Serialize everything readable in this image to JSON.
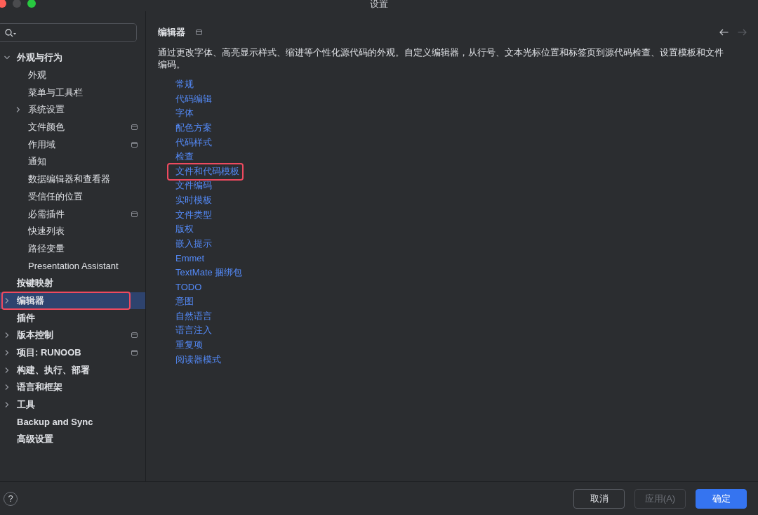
{
  "window": {
    "title": "设置"
  },
  "sidebar": {
    "items": [
      {
        "label": "外观与行为",
        "expanded": true,
        "selected": false,
        "highlighted": false,
        "scope_icon": false,
        "children": [
          {
            "label": "外观",
            "selected": false,
            "highlighted": false,
            "scope_icon": false
          },
          {
            "label": "菜单与工具栏",
            "selected": false,
            "highlighted": false,
            "scope_icon": false
          },
          {
            "label": "系统设置",
            "expanded": false,
            "selected": false,
            "highlighted": false,
            "scope_icon": false
          },
          {
            "label": "文件颜色",
            "selected": false,
            "highlighted": false,
            "scope_icon": true
          },
          {
            "label": "作用域",
            "selected": false,
            "highlighted": false,
            "scope_icon": true
          },
          {
            "label": "通知",
            "selected": false,
            "highlighted": false,
            "scope_icon": false
          },
          {
            "label": "数据编辑器和查看器",
            "selected": false,
            "highlighted": false,
            "scope_icon": false
          },
          {
            "label": "受信任的位置",
            "selected": false,
            "highlighted": false,
            "scope_icon": false
          },
          {
            "label": "必需插件",
            "selected": false,
            "highlighted": false,
            "scope_icon": true
          },
          {
            "label": "快速列表",
            "selected": false,
            "highlighted": false,
            "scope_icon": false
          },
          {
            "label": "路径变量",
            "selected": false,
            "highlighted": false,
            "scope_icon": false
          },
          {
            "label": "Presentation Assistant",
            "selected": false,
            "highlighted": false,
            "scope_icon": false
          }
        ]
      },
      {
        "label": "按键映射",
        "selected": false,
        "highlighted": false,
        "scope_icon": false
      },
      {
        "label": "编辑器",
        "expanded": false,
        "selected": true,
        "highlighted": true,
        "scope_icon": false
      },
      {
        "label": "插件",
        "selected": false,
        "highlighted": false,
        "scope_icon": false
      },
      {
        "label": "版本控制",
        "expanded": false,
        "selected": false,
        "highlighted": false,
        "scope_icon": true
      },
      {
        "label": "项目: RUNOOB",
        "expanded": false,
        "selected": false,
        "highlighted": false,
        "scope_icon": true
      },
      {
        "label": "构建、执行、部署",
        "expanded": false,
        "selected": false,
        "highlighted": false,
        "scope_icon": false
      },
      {
        "label": "语言和框架",
        "expanded": false,
        "selected": false,
        "highlighted": false,
        "scope_icon": false
      },
      {
        "label": "工具",
        "expanded": false,
        "selected": false,
        "highlighted": false,
        "scope_icon": false
      },
      {
        "label": "Backup and Sync",
        "selected": false,
        "highlighted": false,
        "scope_icon": false
      },
      {
        "label": "高级设置",
        "selected": false,
        "highlighted": false,
        "scope_icon": false
      }
    ]
  },
  "page": {
    "title": "编辑器",
    "scope_icon": true,
    "nav": {
      "back": {
        "disabled": false
      },
      "forward": {
        "disabled": true
      }
    },
    "description": "通过更改字体、高亮显示样式、缩进等个性化源代码的外观。自定义编辑器，从行号、文本光标位置和标签页到源代码检查、设置模板和文件编码。",
    "links": [
      {
        "label": "常规",
        "highlighted": false
      },
      {
        "label": "代码编辑",
        "highlighted": false
      },
      {
        "label": "字体",
        "highlighted": false
      },
      {
        "label": "配色方案",
        "highlighted": false
      },
      {
        "label": "代码样式",
        "highlighted": false
      },
      {
        "label": "检查",
        "highlighted": false
      },
      {
        "label": "文件和代码模板",
        "highlighted": true
      },
      {
        "label": "文件编码",
        "highlighted": false
      },
      {
        "label": "实时模板",
        "highlighted": false
      },
      {
        "label": "文件类型",
        "highlighted": false
      },
      {
        "label": "版权",
        "highlighted": false
      },
      {
        "label": "嵌入提示",
        "highlighted": false
      },
      {
        "label": "Emmet",
        "highlighted": false
      },
      {
        "label": "TextMate 捆绑包",
        "highlighted": false
      },
      {
        "label": "TODO",
        "highlighted": false
      },
      {
        "label": "意图",
        "highlighted": false
      },
      {
        "label": "自然语言",
        "highlighted": false
      },
      {
        "label": "语言注入",
        "highlighted": false
      },
      {
        "label": "重复项",
        "highlighted": false
      },
      {
        "label": "阅读器模式",
        "highlighted": false
      }
    ]
  },
  "footer": {
    "help": {
      "label": "?"
    },
    "buttons": [
      {
        "label": "取消",
        "kind": "secondary",
        "disabled": false
      },
      {
        "label": "应用(A)",
        "kind": "secondary",
        "disabled": true
      },
      {
        "label": "确定",
        "kind": "primary",
        "disabled": false
      }
    ]
  }
}
